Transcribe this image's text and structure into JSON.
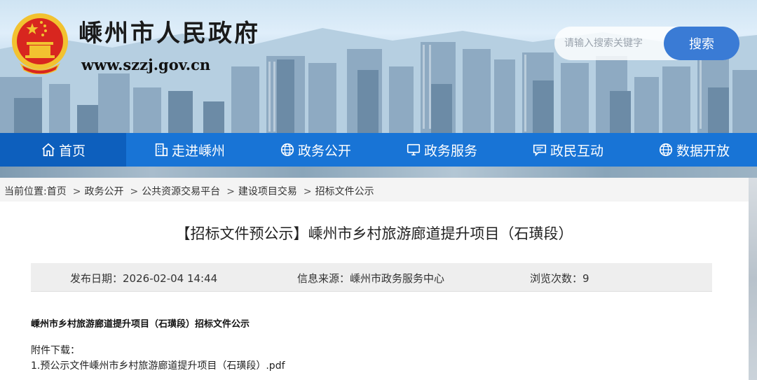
{
  "header": {
    "site_title": "嵊州市人民政府",
    "site_url": "www.szzj.gov.cn",
    "emblem_icon": "national-emblem-icon"
  },
  "search": {
    "placeholder": "请输入搜索关键字",
    "button_label": "搜索"
  },
  "nav": {
    "items": [
      {
        "label": "首页",
        "icon": "home-icon",
        "active": true
      },
      {
        "label": "走进嵊州",
        "icon": "building-icon"
      },
      {
        "label": "政务公开",
        "icon": "globe-icon"
      },
      {
        "label": "政务服务",
        "icon": "monitor-icon"
      },
      {
        "label": "政民互动",
        "icon": "chat-icon"
      },
      {
        "label": "数据开放",
        "icon": "globe-icon"
      }
    ]
  },
  "breadcrumb": {
    "prefix": "当前位置:",
    "items": [
      "首页",
      "政务公开",
      "公共资源交易平台",
      "建设项目交易",
      "招标文件公示"
    ],
    "separator": ">"
  },
  "article": {
    "title": "【招标文件预公示】嵊州市乡村旅游廊道提升项目（石璜段）",
    "publish_label": "发布日期：",
    "publish_date": "2026-02-04 14:44",
    "source_label": "信息来源：",
    "source": "嵊州市政务服务中心",
    "views_label": "浏览次数：",
    "views": "9",
    "doc_heading": "嵊州市乡村旅游廊道提升项目（石璜段）招标文件公示",
    "attachment_label": "附件下载：",
    "attachment_link": "1.预公示文件嵊州市乡村旅游廊道提升项目（石璜段）.pdf"
  },
  "colors": {
    "nav_bg": "#1874d6",
    "nav_active": "#0d5fbd",
    "search_button": "#3a7bd5",
    "emblem_red": "#d8261f",
    "emblem_gold": "#f2c230"
  }
}
